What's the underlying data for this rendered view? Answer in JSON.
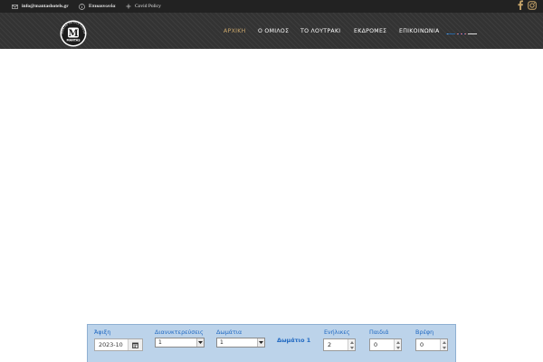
{
  "topbar": {
    "email": "info@mantashotels.gr",
    "contact_label": "Επικοινωνία",
    "covid_label": "Covid Policy"
  },
  "social": {
    "facebook_icon": "facebook-icon",
    "instagram_icon": "instagram-icon"
  },
  "brand": {
    "logo_letter": "M",
    "logo_ring_text": "MANTAS HOTELS GROUP",
    "logo_small_text": "MANTAS",
    "accent_color": "#c9a66b"
  },
  "nav": {
    "items": [
      {
        "label": "ΑΡΧΙΚΗ",
        "active": true
      },
      {
        "label": "Ο ΟΜΙΛΟΣ",
        "active": false
      },
      {
        "label": "ΤΟ ΛΟΥΤΡΑΚΙ",
        "active": false
      },
      {
        "label": "ΕΚΔΡΟΜΕΣ",
        "active": false
      },
      {
        "label": "ΕΠΙΚΟΙΝΩΝΙΑ",
        "active": false
      }
    ],
    "languages": [
      "Greek",
      "English",
      "Russian"
    ]
  },
  "booking": {
    "arrival_label": "Άφιξη",
    "arrival_value": "2023-10",
    "nights_label": "Διανυκτερεύσεις",
    "nights_value": "1",
    "rooms_label": "Δωμάτια",
    "rooms_value": "1",
    "room_title": "Δωμάτιο 1",
    "adults_label": "Ενήλικες",
    "adults_value": "2",
    "children_label": "Παιδιά",
    "children_value": "0",
    "infants_label": "Βρέφη",
    "infants_value": "0"
  }
}
